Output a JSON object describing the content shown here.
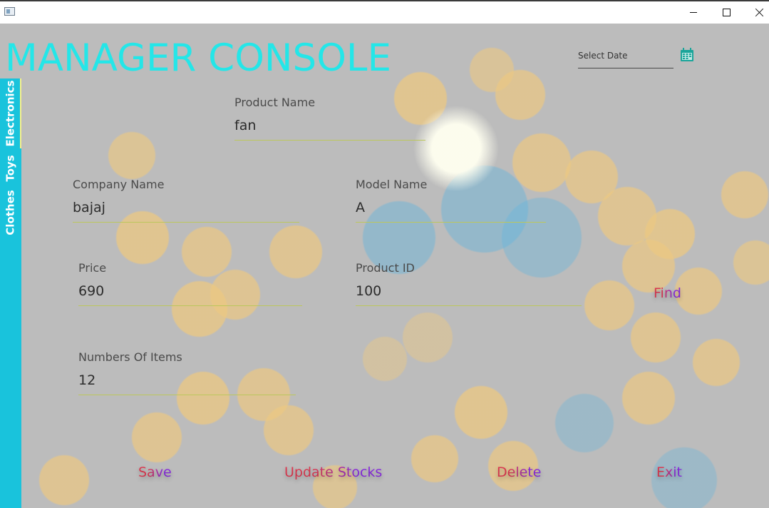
{
  "window": {
    "title": "",
    "controls": {
      "minimize": "minimize-icon",
      "maximize": "maximize-icon",
      "close": "close-icon"
    }
  },
  "header": {
    "title": "MANAGER CONSOLE",
    "title_color": "#24e6e8",
    "date_picker": {
      "placeholder": "Select Date",
      "value": "",
      "icon": "calendar-icon"
    }
  },
  "sidebar": {
    "color": "#19c3dc",
    "tabs": [
      {
        "label": "Electronics",
        "active": true
      },
      {
        "label": "Toys",
        "active": false
      },
      {
        "label": "Clothes",
        "active": false
      }
    ]
  },
  "form": {
    "product_name": {
      "label": "Product Name",
      "value": "fan"
    },
    "company_name": {
      "label": "Company Name",
      "value": "bajaj"
    },
    "model_name": {
      "label": "Model Name",
      "value": "A"
    },
    "price": {
      "label": "Price",
      "value": "690"
    },
    "product_id": {
      "label": "Product ID",
      "value": "100"
    },
    "numbers_of_items": {
      "label": "Numbers Of Items",
      "value": "12"
    }
  },
  "actions": {
    "find": "Find",
    "save": "Save",
    "update_stocks": "Update Stocks",
    "delete": "Delete",
    "exit": "Exit"
  },
  "colors": {
    "button_text_start": "#e03a52",
    "button_text_end": "#8a2be2",
    "field_underline": "#bcc75c"
  }
}
